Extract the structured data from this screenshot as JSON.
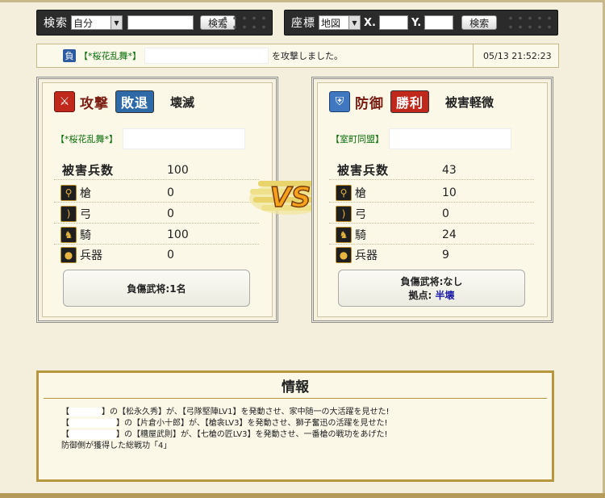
{
  "search_bar": {
    "label": "検索",
    "scope_select": "自分",
    "query_value": "",
    "search_button": "検索"
  },
  "coord_bar": {
    "label": "座標",
    "map_select": "地図",
    "x_label": "X.",
    "x_value": "",
    "y_label": "Y.",
    "y_value": "",
    "search_button": "検索"
  },
  "notice": {
    "badge": "負",
    "attacker_link": "【*桜花乱舞*】",
    "action_text": "を攻撃しました。",
    "timestamp": "05/13 21:52:23"
  },
  "attacker": {
    "role": "攻撃",
    "result": "敗退",
    "status": "壊滅",
    "alliance": "【*桜花乱舞*】",
    "total_label": "被害兵数",
    "total_value": "100",
    "units": [
      {
        "icon": "spear-icon",
        "label": "槍",
        "value": "0"
      },
      {
        "icon": "bow-icon",
        "label": "弓",
        "value": "0"
      },
      {
        "icon": "horse-icon",
        "label": "騎",
        "value": "100"
      },
      {
        "icon": "siege-icon",
        "label": "兵器",
        "value": "0"
      }
    ],
    "summary_line1": "負傷武将:1名"
  },
  "defender": {
    "role": "防御",
    "result": "勝利",
    "status": "被害軽微",
    "alliance": "【室町同盟】",
    "total_label": "被害兵数",
    "total_value": "43",
    "units": [
      {
        "icon": "spear-icon",
        "label": "槍",
        "value": "10"
      },
      {
        "icon": "bow-icon",
        "label": "弓",
        "value": "0"
      },
      {
        "icon": "horse-icon",
        "label": "騎",
        "value": "24"
      },
      {
        "icon": "siege-icon",
        "label": "兵器",
        "value": "9"
      }
    ],
    "summary_line1": "負傷武将:なし",
    "summary_line2_label": "拠点:",
    "summary_line2_value": "半壊"
  },
  "vs_text": "VS",
  "info": {
    "title": "情報",
    "lines": [
      {
        "pre": "【",
        "post": "】の【松永久秀】が、【弓隊堅陣LV1】を発動させ、家中随一の大活躍を見せた!"
      },
      {
        "pre": "【",
        "post": "】の【片倉小十郎】が、【槍衾LV3】を発動させ、獅子奮迅の活躍を見せた!"
      },
      {
        "pre": "【",
        "post": "】の【糟屋武則】が、【七槍の匠LV3】を発動させ、一番槍の戦功をあげた!"
      }
    ],
    "total_line": "防御側が獲得した総戦功「4」"
  },
  "colors": {
    "background": "#f3efdc",
    "attack_red": "#c0281c",
    "retreat_blue": "#2f6aa8",
    "victory_red": "#c0281c",
    "defense_blue": "#3f78c0",
    "link_green": "#0a6e0a",
    "half_destroyed_blue": "#1a1aa8"
  }
}
